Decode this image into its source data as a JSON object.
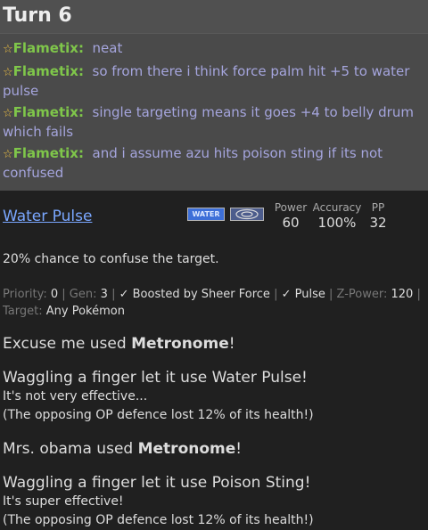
{
  "turn_header": "Turn 6",
  "chat": [
    {
      "star": "☆",
      "user": "Flametix:",
      "text": "neat"
    },
    {
      "star": "☆",
      "user": "Flametix:",
      "text": "so from there i think force palm hit +5 to water pulse"
    },
    {
      "star": "☆",
      "user": "Flametix:",
      "text": "single targeting means it goes +4 to belly drum which fails"
    },
    {
      "star": "☆",
      "user": "Flametix:",
      "text": "and i assume azu hits poison sting if its not confused"
    }
  ],
  "move": {
    "name": "Water Pulse",
    "type": "WATER",
    "category_icon": "special-category-icon",
    "power_label": "Power",
    "power": "60",
    "accuracy_label": "Accuracy",
    "accuracy": "100%",
    "pp_label": "PP",
    "pp": "32",
    "description": "20% chance to confuse the target.",
    "priority_label": "Priority:",
    "priority": "0",
    "gen_label": "Gen:",
    "gen": "3",
    "flag1": "✓ Boosted by Sheer Force",
    "flag2": "✓ Pulse",
    "zpower_label": "Z-Power:",
    "zpower": "120",
    "target_label": "Target:",
    "target": "Any Pokémon"
  },
  "log": [
    {
      "pre": "Excuse me used ",
      "bold": "Metronome",
      "post": "!"
    },
    {
      "text": "Waggling a finger let it use Water Pulse!"
    },
    {
      "sub": "It's not very effective..."
    },
    {
      "sub": "(The opposing OP defence lost 12% of its health!)"
    },
    {
      "pre": "Mrs. obama used ",
      "bold": "Metronome",
      "post": "!"
    },
    {
      "text": "Waggling a finger let it use Poison Sting!"
    },
    {
      "sub": "It's super effective!"
    },
    {
      "sub": "(The opposing OP defence lost 12% of its health!)"
    }
  ]
}
